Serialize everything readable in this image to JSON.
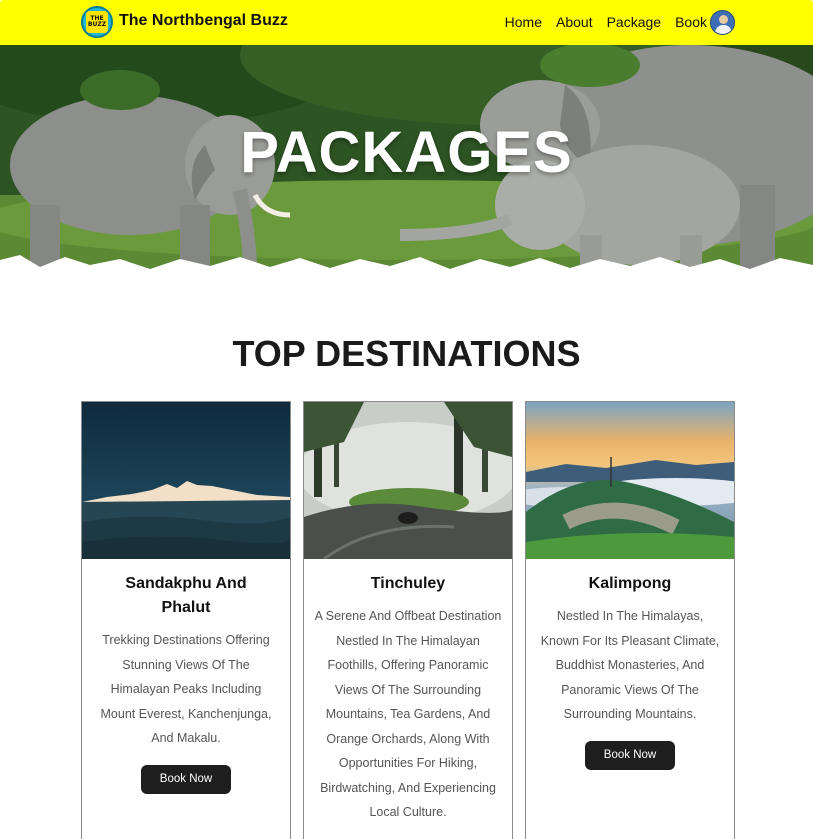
{
  "navbar": {
    "logo_top": "THE",
    "logo_bottom": "BUZZ",
    "brand": "The Northbengal Buzz",
    "links": [
      "Home",
      "About",
      "Package",
      "Book"
    ],
    "background": "#ffff00"
  },
  "hero": {
    "title": "PACKAGES"
  },
  "section": {
    "title": "TOP DESTINATIONS"
  },
  "cards": [
    {
      "title": "Sandakphu And Phalut",
      "description": "Trekking Destinations Offering Stunning Views Of The Himalayan Peaks Including Mount Everest, Kanchenjunga, And Makalu.",
      "button": "Book Now"
    },
    {
      "title": "Tinchuley",
      "description": "A Serene And Offbeat Destination Nestled In The Himalayan Foothills, Offering Panoramic Views Of The Surrounding Mountains, Tea Gardens, And Orange Orchards, Along With Opportunities For Hiking, Birdwatching, And Experiencing Local Culture.",
      "button": ""
    },
    {
      "title": "Kalimpong",
      "description": "Nestled In The Himalayas, Known For Its Pleasant Climate, Buddhist Monasteries, And Panoramic Views Of The Surrounding Mountains.",
      "button": "Book Now"
    }
  ]
}
